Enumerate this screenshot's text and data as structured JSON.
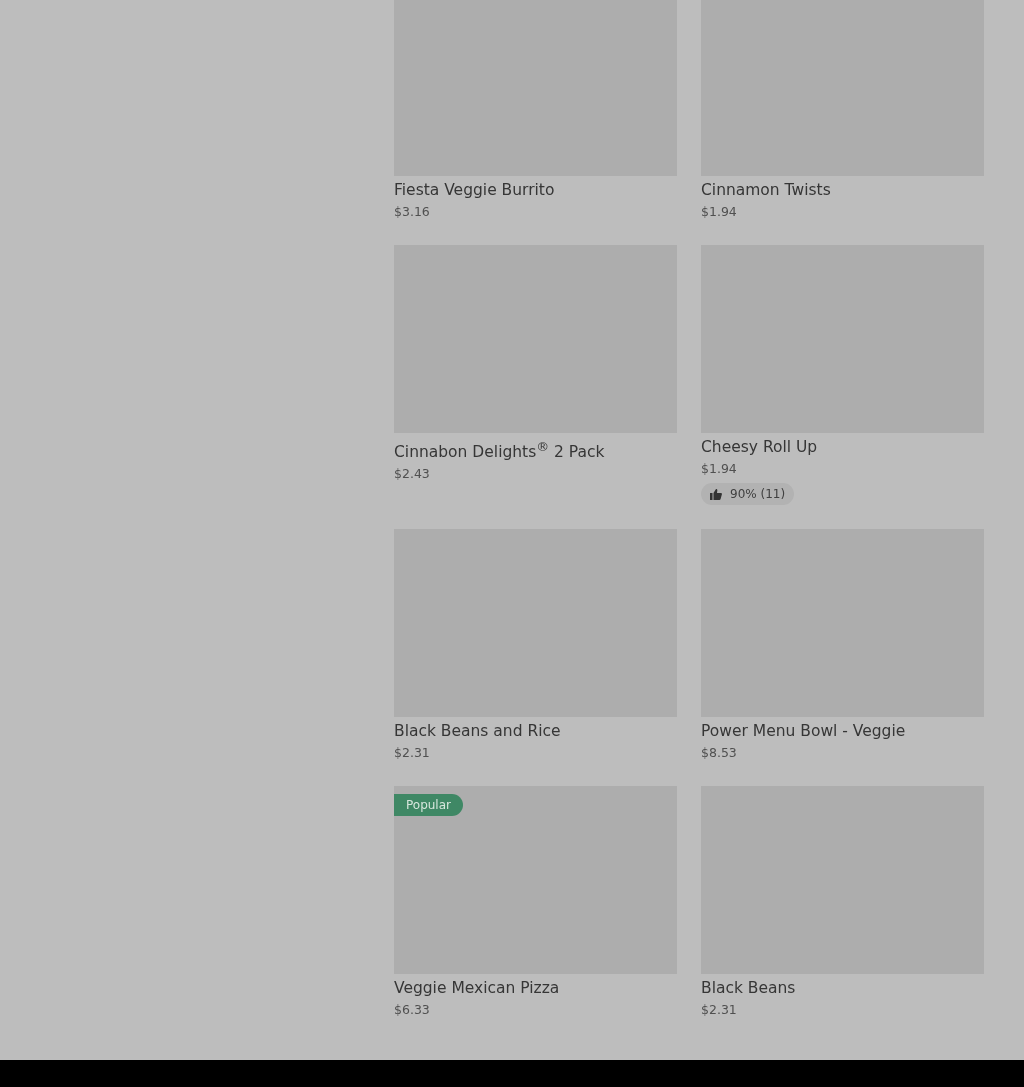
{
  "menu_items": [
    {
      "name": "Fiesta Veggie Burrito",
      "price": "$3.16"
    },
    {
      "name": "Cinnamon Twists",
      "price": "$1.94"
    },
    {
      "name": "Cinnabon Delights$^{®}$ 2 Pack",
      "price": "$2.43"
    },
    {
      "name": "Cheesy Roll Up",
      "price": "$1.94",
      "rating": "90% (11)"
    },
    {
      "name": "Black Beans and Rice",
      "price": "$2.31"
    },
    {
      "name": "Power Menu Bowl - Veggie",
      "price": "$8.53"
    },
    {
      "name": "Veggie Mexican Pizza",
      "price": "$6.33",
      "badge": "Popular"
    },
    {
      "name": "Black Beans",
      "price": "$2.31"
    }
  ]
}
